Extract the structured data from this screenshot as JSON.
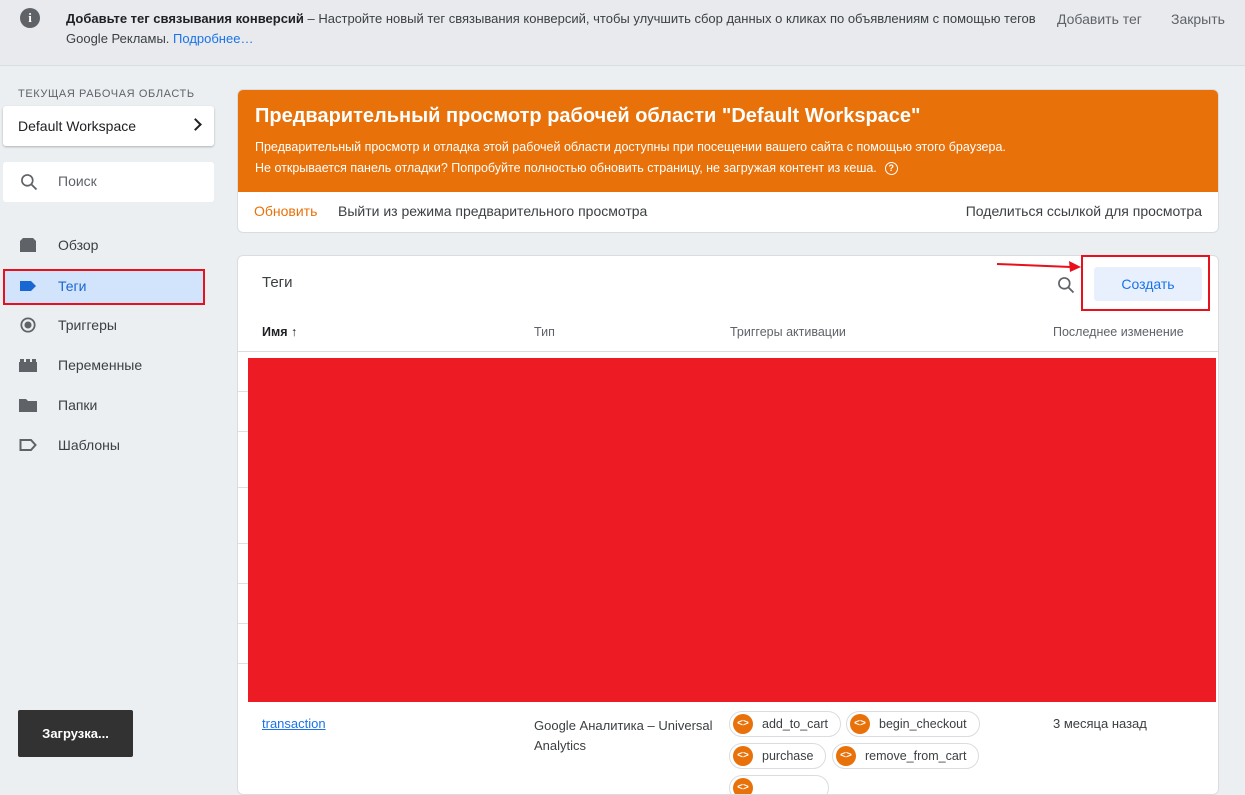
{
  "notice": {
    "bold": "Добавьте тег связывания конверсий",
    "text": " – Настройте новый тег связывания конверсий, чтобы улучшить сбор данных о кликах по объявлениям с помощью тегов Google Рекламы.",
    "more": "Подробнее…",
    "add_tag": "Добавить тег",
    "close": "Закрыть"
  },
  "sidebar": {
    "workspace_label": "ТЕКУЩАЯ РАБОЧАЯ ОБЛАСТЬ",
    "workspace_name": "Default Workspace",
    "search_placeholder": "Поиск",
    "items": [
      {
        "label": "Обзор",
        "icon": "overview-icon"
      },
      {
        "label": "Теги",
        "icon": "tag-icon"
      },
      {
        "label": "Триггеры",
        "icon": "trigger-icon"
      },
      {
        "label": "Переменные",
        "icon": "variables-icon"
      },
      {
        "label": "Папки",
        "icon": "folder-icon"
      },
      {
        "label": "Шаблоны",
        "icon": "template-icon"
      }
    ],
    "toast": "Загрузка..."
  },
  "preview": {
    "title": "Предварительный просмотр рабочей области \"Default Workspace\"",
    "line1": "Предварительный просмотр и отладка этой рабочей области доступны при посещении вашего сайта с помощью этого браузера.",
    "line2": "Не открывается панель отладки? Попробуйте полностью обновить страницу, не загружая контент из кеша.",
    "refresh": "Обновить",
    "exit": "Выйти из режима предварительного просмотра",
    "share": "Поделиться ссылкой для просмотра"
  },
  "tags": {
    "title": "Теги",
    "create": "Создать",
    "columns": {
      "name": "Имя",
      "type": "Тип",
      "triggers": "Триггеры активации",
      "modified": "Последнее изменение"
    },
    "row": {
      "name": "transaction",
      "type": "Google Аналитика – Universal Analytics",
      "triggers": [
        "add_to_cart",
        "begin_checkout",
        "purchase",
        "remove_from_cart"
      ],
      "modified": "3 месяца назад"
    }
  },
  "colors": {
    "accent": "#1a73e8",
    "preview_banner": "#e8710a",
    "highlight": "#e8101b"
  }
}
